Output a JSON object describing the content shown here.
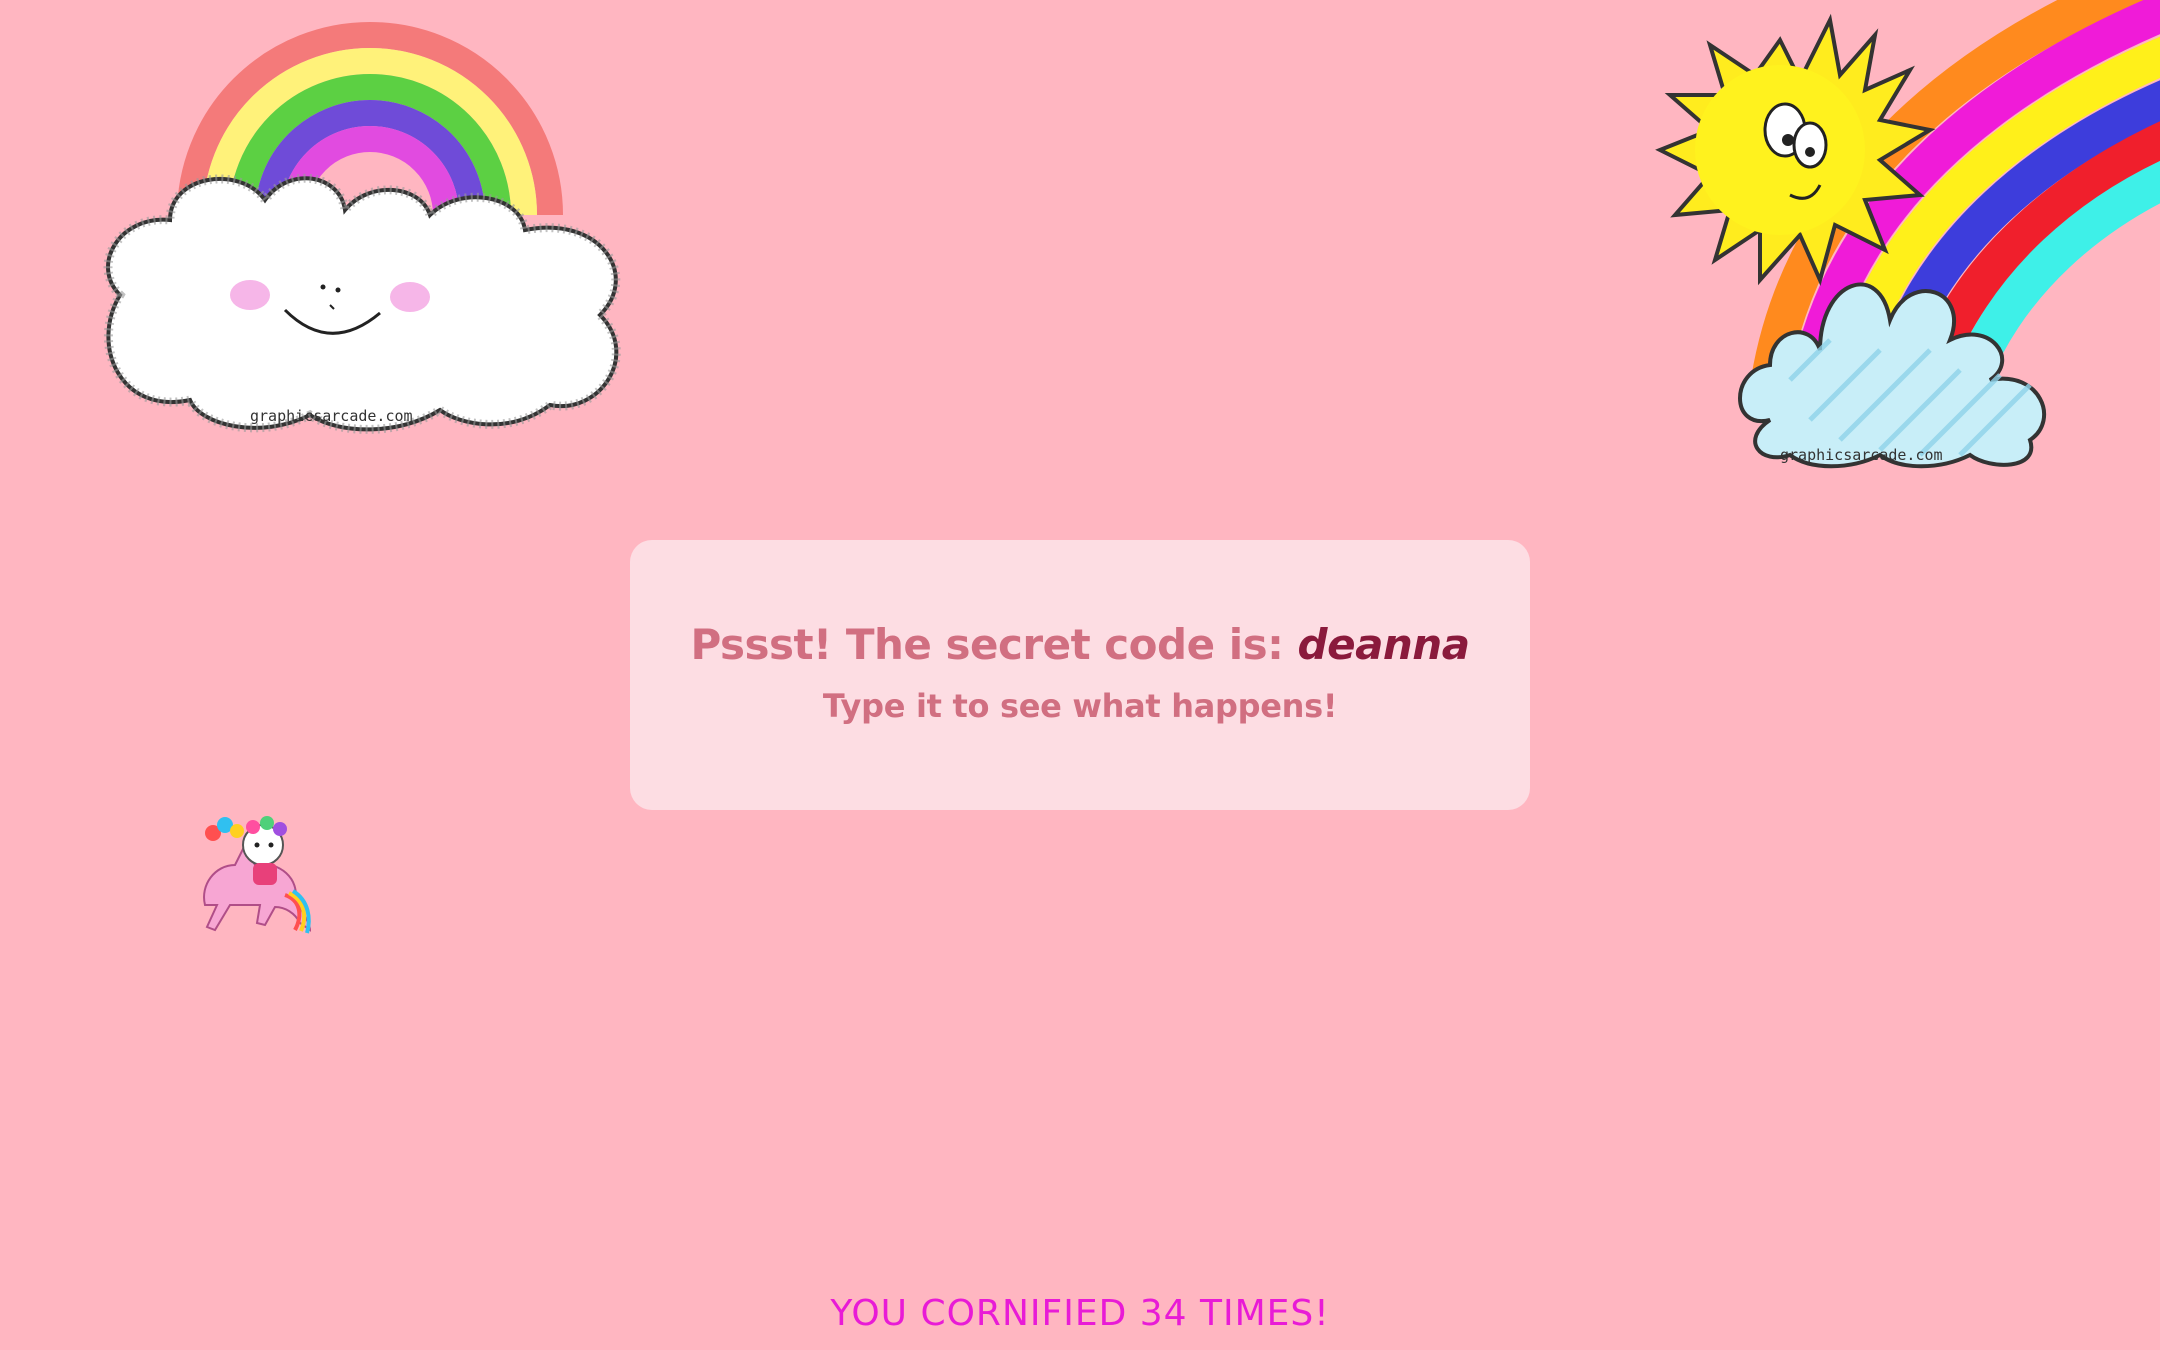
{
  "stickers": {
    "rainbow_cloud": {
      "icon": "rainbow-cloud-icon",
      "watermark": "graphicsarcade.com"
    },
    "sun_rainbow": {
      "icon": "sun-rainbow-icon",
      "watermark": "graphicsarcade.com"
    },
    "unicorn": {
      "icon": "kitty-unicorn-icon"
    }
  },
  "message": {
    "prefix": "Pssst! The secret code is:",
    "code": "deanna",
    "hint": "Type it to see what happens!"
  },
  "counter": {
    "text": "YOU CORNIFIED 34 TIMES!"
  },
  "colors": {
    "background": "#ffb6c1",
    "box": "#fddde3",
    "text": "#d16f81",
    "code": "#8a1a3c",
    "counter": "#e81bd6"
  }
}
